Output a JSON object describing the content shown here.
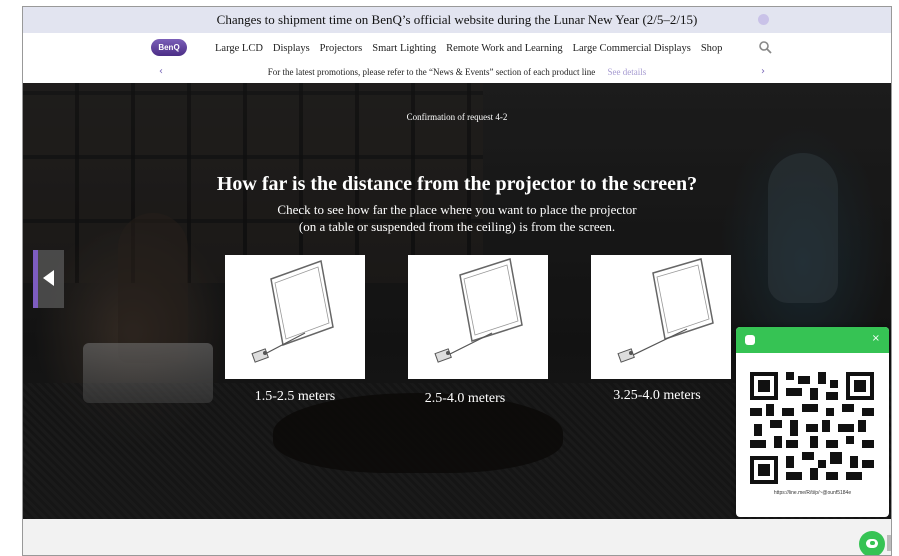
{
  "announcement": {
    "text": "Changes to shipment time on BenQ’s official website during the Lunar New Year (2/5–2/15)"
  },
  "nav": {
    "logo_text": "BenQ",
    "items": [
      "Large LCD",
      "Displays",
      "Projectors",
      "Smart Lighting",
      "Remote Work and Learning",
      "Large Commercial Displays",
      "Shop"
    ],
    "search_icon": "search-icon"
  },
  "promo": {
    "text": "For the latest promotions, please refer to the “News & Events” section of each product line",
    "link": "See details",
    "prev_icon": "chevron-left-icon",
    "next_icon": "chevron-right-icon"
  },
  "hero": {
    "confirmation": "Confirmation of request 4-2",
    "title": "How far is the distance from the projector to the screen?",
    "description_line1": "Check to see how far the place where you want to place the projector",
    "description_line2": "(on a table or suspended from the ceiling) is from the screen.",
    "options": [
      {
        "label": "1.5-2.5 meters"
      },
      {
        "label": "2.5-4.0 meters"
      },
      {
        "label": "3.25-4.0 meters"
      }
    ],
    "prev_icon": "arrow-left-icon"
  },
  "qr_popup": {
    "header_icon": "line-icon",
    "close_icon": "close-icon",
    "url": "https://line.me/R/ti/p/~@ounf5184e"
  },
  "colors": {
    "accent": "#7b5fb8",
    "line_green": "#36c354",
    "announce_bg": "#e2e4f0"
  }
}
